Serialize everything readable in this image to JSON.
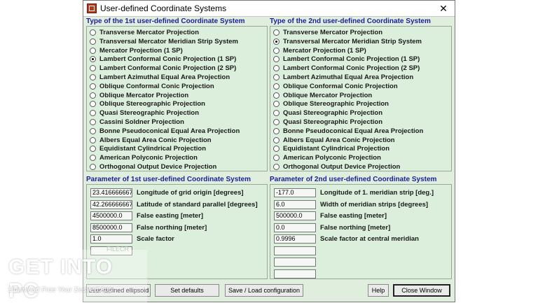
{
  "window": {
    "title": "User-defined Coordinate Systems",
    "close_symbol": "✕"
  },
  "panel1": {
    "title": "Type of the 1st user-defined Coordinate System",
    "selected_index": 3,
    "options": [
      "Transverse Mercator Projection",
      "Transversal Mercator Meridian Strip System",
      "Mercator Projection (1 SP)",
      "Lambert Conformal Conic Projection (1 SP)",
      "Lambert Conformal Conic Projection (2 SP)",
      "Lambert Azimuthal Equal Area Projection",
      "Oblique Conformal Conic Projection",
      "Oblique Mercator Projection",
      "Oblique Stereographic Projection",
      "Quasi Stereographic Projection",
      "Cassini Soldner Projection",
      "Bonne Pseudoconical Equal Area Projection",
      "Albers Equal Area Conic Projection",
      "Equidistant Cylindrical Projection",
      "American Polyconic Projection",
      "Orthogonal Output Device Projection"
    ]
  },
  "panel2": {
    "title": "Type of the 2nd user-defined Coordinate System",
    "selected_index": 1,
    "options": [
      "Transverse Mercator Projection",
      "Transversal Mercator Meridian Strip System",
      "Mercator Projection (1 SP)",
      "Lambert Conformal Conic Projection (1 SP)",
      "Lambert Conformal Conic Projection (2 SP)",
      "Lambert Azimuthal Equal Area Projection",
      "Oblique Conformal Conic Projection",
      "Oblique Mercator Projection",
      "Oblique Stereographic Projection",
      "Quasi Stereographic Projection",
      "Quasi Stereographic Projection",
      "Bonne Pseudoconical Equal Area Projection",
      "Albers Equal Area Conic Projection",
      "Equidistant Cylindrical Projection",
      "American Polyconic Projection",
      "Orthogonal Output Device Projection"
    ]
  },
  "params1": {
    "title": "Parameter of 1st user-defined Coordinate System",
    "rows": [
      {
        "value": "23.416666667",
        "label": "Longitude of grid origin [degrees]"
      },
      {
        "value": "42.266666667",
        "label": "Latitude of standard parallel [degrees]"
      },
      {
        "value": "4500000.0",
        "label": "False easting [meter]"
      },
      {
        "value": "8500000.0",
        "label": "False northing [meter]"
      },
      {
        "value": "1.0",
        "label": "Scale factor"
      }
    ]
  },
  "params2": {
    "title": "Parameter of 2nd user-defined Coordinate System",
    "rows": [
      {
        "value": "-177.0",
        "label": "Longitude of 1. meridian strip [deg.]"
      },
      {
        "value": "6.0",
        "label": "Width of meridian strips [degrees]"
      },
      {
        "value": "500000.0",
        "label": "False easting [meter]"
      },
      {
        "value": "0.0",
        "label": "False northing [meter]"
      },
      {
        "value": "0.9996",
        "label": "Scale factor at central meridian"
      }
    ]
  },
  "buttons": {
    "ellipsoid": "User-defined ellipsoid",
    "defaults": "Set defaults",
    "config": "Save / Load configuration",
    "help": "Help",
    "close": "Close Window"
  },
  "watermark": {
    "main": "GET INTO PC",
    "sub": "Download Free Your Desired App",
    "small": "FILECR"
  }
}
